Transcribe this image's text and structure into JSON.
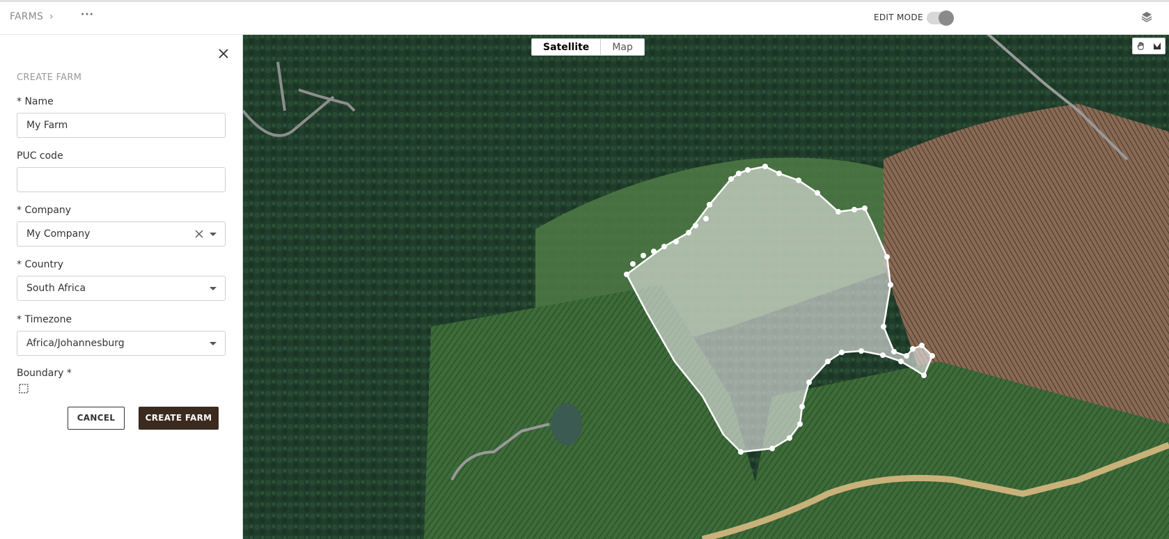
{
  "header": {
    "breadcrumb": "FARMS",
    "chevron": "›",
    "more": "···",
    "edit_mode_label": "EDIT MODE",
    "edit_mode_on": true,
    "layers_icon": "layers-icon"
  },
  "form": {
    "title": "CREATE FARM",
    "name_label": "* Name",
    "name_value": "My Farm",
    "puc_label": "PUC code",
    "puc_value": "",
    "company_label": "* Company",
    "company_value": "My Company",
    "country_label": "* Country",
    "country_value": "South Africa",
    "timezone_label": "* Timezone",
    "timezone_value": "Africa/Johannesburg",
    "boundary_label": "Boundary *",
    "cancel_label": "CANCEL",
    "create_label": "CREATE FARM"
  },
  "map": {
    "satellite_label": "Satellite",
    "map_label": "Map",
    "active_layer": "Satellite",
    "tools": [
      "hand-icon",
      "draw-polygon-icon"
    ]
  },
  "colors": {
    "primary_button": "#3b2a1e",
    "boundary_stroke": "#ffffff"
  }
}
